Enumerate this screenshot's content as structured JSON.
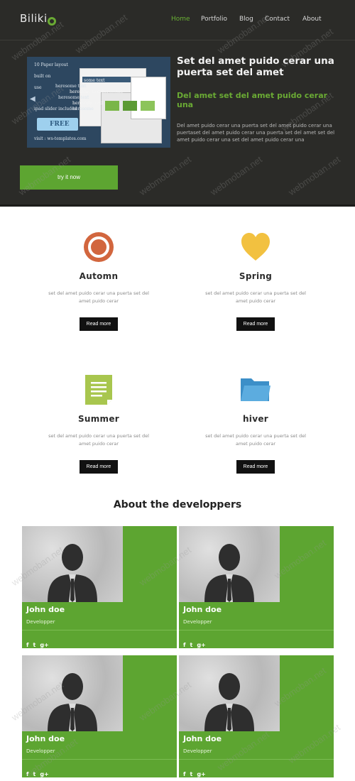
{
  "header": {
    "logo": "Biliki",
    "nav": [
      {
        "label": "Home",
        "active": true
      },
      {
        "label": "Portfolio",
        "active": false
      },
      {
        "label": "Blog",
        "active": false
      },
      {
        "label": "Contact",
        "active": false
      },
      {
        "label": "About",
        "active": false
      }
    ]
  },
  "hero": {
    "slider_lines": [
      "10 Paper layout",
      "built on",
      "some text",
      "heresome text",
      "heresome text heresome",
      "heresome text",
      "use",
      "heresome text",
      "heresome",
      "ipad slider included",
      "FREE",
      "visit : ws-templates.com"
    ],
    "title": "Set del amet puido cerar una puerta set del amet",
    "subtitle": "Del amet set del amet puido cerar una",
    "body": "Del amet puido cerar una puerta set del amet puido cerar una puertaset del amet puido cerar una puerta set del amet set del amet puido cerar una set del amet puido cerar una",
    "cta_label": "try it now"
  },
  "features": [
    {
      "icon": "target-ring-icon",
      "title": "Automn",
      "text": "set del amet puido cerar una puerta set del amet puido cerar",
      "button": "Read more"
    },
    {
      "icon": "heart-icon",
      "title": "Spring",
      "text": "set del amet puido cerar una puerta set del amet puido cerar",
      "button": "Read more"
    },
    {
      "icon": "document-icon",
      "title": "Summer",
      "text": "set del amet puido cerar una puerta set del amet puido cerar",
      "button": "Read more"
    },
    {
      "icon": "folder-icon",
      "title": "hiver",
      "text": "set del amet puido cerar una puerta set del amet puido cerar",
      "button": "Read more"
    }
  ],
  "about": {
    "title": "About the developpers",
    "members": [
      {
        "name": "John doe",
        "role": "Developper",
        "socials": [
          "f",
          "t",
          "g+"
        ]
      },
      {
        "name": "John doe",
        "role": "Developper",
        "socials": [
          "f",
          "t",
          "g+"
        ]
      },
      {
        "name": "John doe",
        "role": "Developper",
        "socials": [
          "f",
          "t",
          "g+"
        ]
      },
      {
        "name": "John doe",
        "role": "Developper",
        "socials": [
          "f",
          "t",
          "g+"
        ]
      }
    ]
  },
  "watermark": "webmoban.net",
  "colors": {
    "accent_green": "#5da531",
    "dark_bg": "#2b2b28",
    "button_black": "#111111"
  }
}
